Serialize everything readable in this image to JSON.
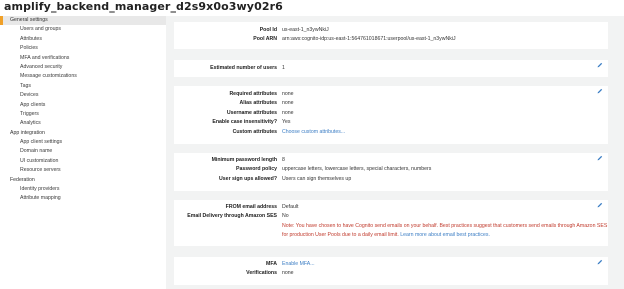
{
  "page": {
    "title": "amplify_backend_manager_d2s9x0o3wy02r6"
  },
  "sidebar": {
    "sections": [
      {
        "label": "General settings",
        "active": true,
        "items": [
          "Users and groups",
          "Attributes",
          "Policies",
          "MFA and verifications",
          "Advanced security",
          "Message customizations",
          "Tags",
          "Devices",
          "App clients",
          "Triggers",
          "Analytics"
        ]
      },
      {
        "label": "App integration",
        "active": false,
        "items": [
          "App client settings",
          "Domain name",
          "UI customization",
          "Resource servers"
        ]
      },
      {
        "label": "Federation",
        "active": false,
        "items": [
          "Identity providers",
          "Attribute mapping"
        ]
      }
    ]
  },
  "pool": {
    "id_label": "Pool Id",
    "id_value": "us-east-1_n3ywNkiJ",
    "arn_label": "Pool ARN",
    "arn_value": "arn:aws:cognito-idp:us-east-1:564761018671:userpool/us-east-1_n3ywNkiJ"
  },
  "users": {
    "label": "Estimated number of users",
    "value": "1"
  },
  "attributes": {
    "required_label": "Required attributes",
    "required_value": "none",
    "alias_label": "Alias attributes",
    "alias_value": "none",
    "username_label": "Username attributes",
    "username_value": "none",
    "case_label": "Enable case insensitivity?",
    "case_value": "Yes",
    "custom_label": "Custom attributes",
    "custom_link": "Choose custom attributes..."
  },
  "policies": {
    "minpw_label": "Minimum password length",
    "minpw_value": "8",
    "pwpolicy_label": "Password policy",
    "pwpolicy_value": "uppercase letters, lowercase letters, special characters, numbers",
    "signup_label": "User sign ups allowed?",
    "signup_value": "Users can sign themselves up"
  },
  "email": {
    "from_label": "FROM email address",
    "from_value": "Default",
    "ses_label": "Email Delivery through Amazon SES",
    "ses_value": "No",
    "note_line1": "Note: You have chosen to have Cognito send emails on your behalf. Best practices suggest that customers send emails through Amazon SES",
    "note_line2": "for production User Pools due to a daily email limit.",
    "note_link": "Learn more about email best practices."
  },
  "mfa": {
    "mfa_label": "MFA",
    "mfa_link": "Enable MFA...",
    "verif_label": "Verifications",
    "verif_value": "none"
  },
  "colors": {
    "accent": "#f0a028",
    "link": "#3b7dc4",
    "note": "#c0392b",
    "content_bg": "#f2f3f3"
  },
  "icons": {
    "edit": "pencil-icon"
  }
}
